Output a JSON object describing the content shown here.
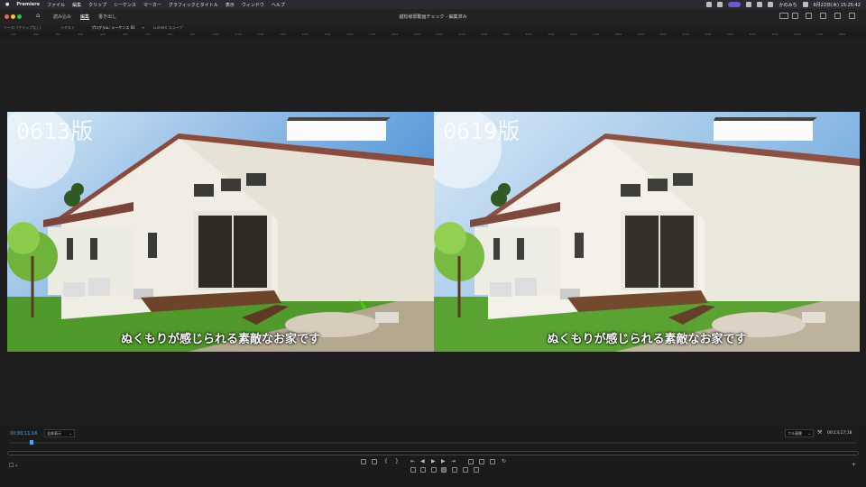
{
  "menubar": {
    "apple": "",
    "app": "Premiere",
    "items": [
      "ファイル",
      "編集",
      "クリップ",
      "シーケンス",
      "マーカー",
      "グラフィックとタイトル",
      "表示",
      "ウィンドウ",
      "ヘルプ"
    ],
    "clock": "6月22日(木) 15:25:42",
    "user": "かのみち"
  },
  "app_header": {
    "workspaces": [
      "読み込み",
      "編集",
      "書き出し"
    ],
    "active_workspace": "編集",
    "project_title": "越松様邸動画チェック - 編集済み"
  },
  "panel_tabs": [
    "ソース: (クリップなし)",
    "テキスト",
    "プログラム: シーケンス 01",
    "Lumetri スコープ"
  ],
  "active_tab": "プログラム: シーケンス 01",
  "ruler_ticks": [
    "100",
    "200",
    "300",
    "400",
    "500",
    "600",
    "700",
    "800",
    "900",
    "1000",
    "1100",
    "1200",
    "1300",
    "1400",
    "1500",
    "1600",
    "1700",
    "1800",
    "1900",
    "2000",
    "2100",
    "2200",
    "2300",
    "2400",
    "2500",
    "2600",
    "2700",
    "2800",
    "2900",
    "3000",
    "3100",
    "3200",
    "3300",
    "3400",
    "3500",
    "3600",
    "3700",
    "3800"
  ],
  "left_frame": {
    "version": "0613版",
    "subtitle": "ぬくもりが感じられる素敵なお家です"
  },
  "right_frame": {
    "version": "0619版",
    "subtitle": "ぬくもりが感じられる素敵なお家です"
  },
  "playback": {
    "timecode_current": "00;00;11;16",
    "fit_left": "全体表示",
    "fit_right": "フル画質",
    "timecode_duration": "00;13;17;18"
  },
  "colors": {
    "accent": "#4da3ff",
    "panel": "#1e1e1e"
  }
}
